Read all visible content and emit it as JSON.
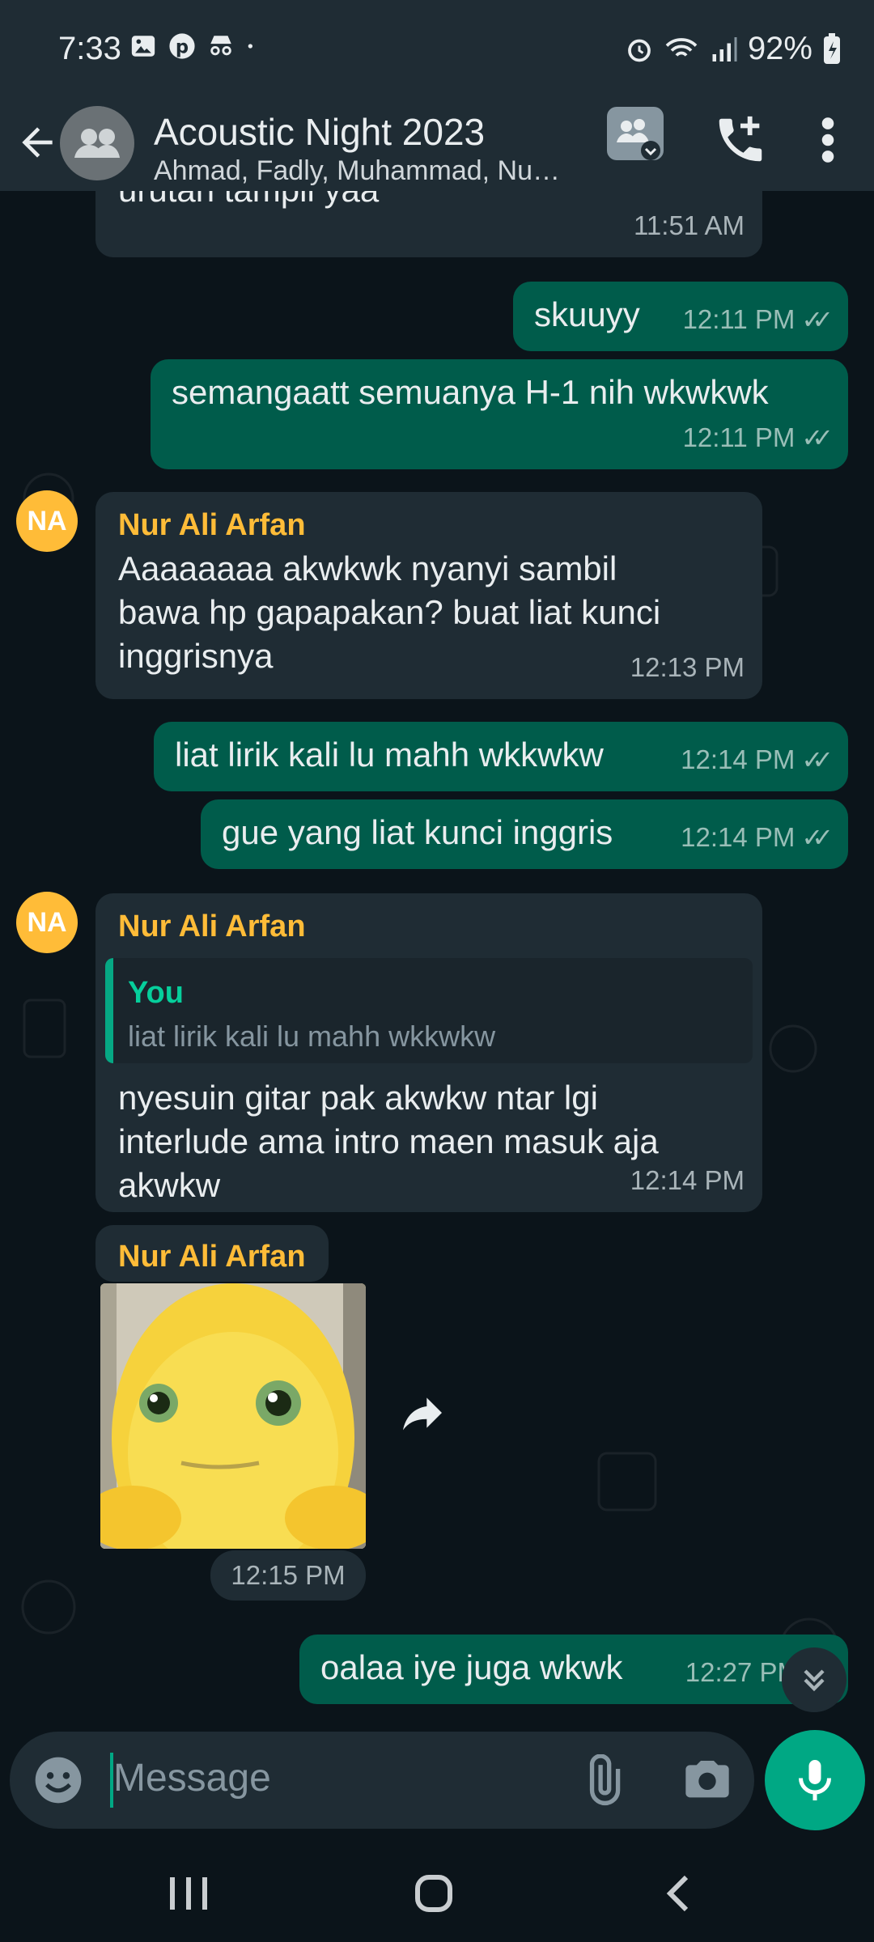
{
  "status_bar": {
    "time": "7:33",
    "battery": "92%"
  },
  "header": {
    "title": "Acoustic Night 2023",
    "subtitle": "Ahmad, Fadly, Muhammad, Nu…"
  },
  "messages": [
    {
      "id": "m0",
      "type": "in",
      "text": "urutan tampil yaa",
      "time": "11:51 AM"
    },
    {
      "id": "m1",
      "type": "out",
      "text": "skuuyy",
      "time": "12:11 PM"
    },
    {
      "id": "m2",
      "type": "out",
      "text": "semangaatt semuanya H-1 nih wkwkwk",
      "time": "12:11 PM"
    },
    {
      "id": "m3",
      "type": "in",
      "sender": "Nur Ali Arfan",
      "avatar": "NA",
      "text_lines": [
        "Aaaaaaaa akwkwk nyanyi sambil",
        "bawa hp gapapakan? buat liat kunci",
        "inggrisnya"
      ],
      "time": "12:13 PM"
    },
    {
      "id": "m4",
      "type": "out",
      "text": "liat lirik kali lu mahh wkkwkw",
      "time": "12:14 PM"
    },
    {
      "id": "m5",
      "type": "out",
      "text": "gue yang liat kunci inggris",
      "time": "12:14 PM"
    },
    {
      "id": "m6",
      "type": "in",
      "sender": "Nur Ali Arfan",
      "avatar": "NA",
      "quote_name": "You",
      "quote_text": "liat lirik kali lu mahh wkkwkw",
      "text_lines": [
        "nyesuin gitar pak akwkw ntar lgi",
        "interlude ama intro maen masuk aja",
        "akwkw"
      ],
      "time": "12:14 PM"
    },
    {
      "id": "m7",
      "type": "sticker",
      "sender": "Nur Ali Arfan",
      "time": "12:15 PM"
    },
    {
      "id": "m8",
      "type": "out",
      "text": "oalaa iye juga wkwk",
      "time": "12:27 PM"
    }
  ],
  "input": {
    "placeholder": "Message"
  },
  "colors": {
    "accent": "#00a884",
    "outgoing_bubble": "#005c4b",
    "incoming_bubble": "#1f2c34",
    "sender_name": "#ffbc38"
  }
}
